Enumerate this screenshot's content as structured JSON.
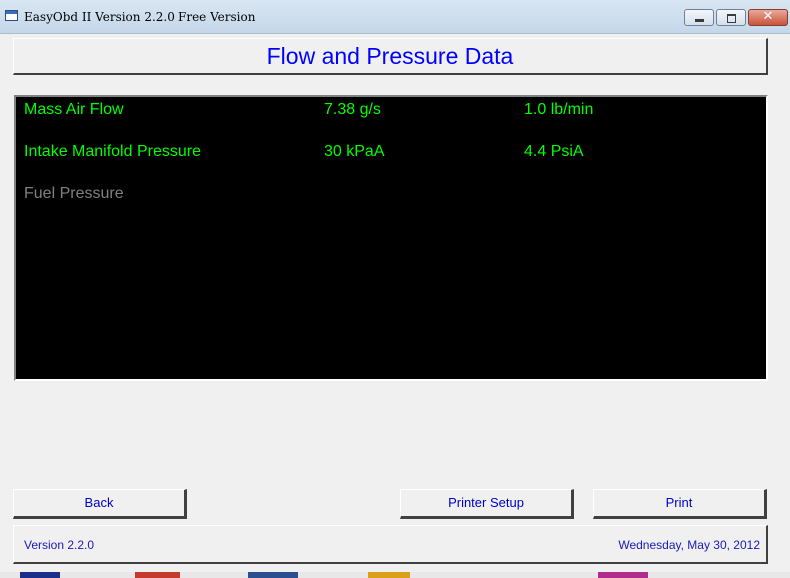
{
  "window": {
    "title": "EasyObd II Version 2.2.0",
    "edition": "Free Version",
    "close_glyph": "✕"
  },
  "header": {
    "title": "Flow and Pressure Data"
  },
  "data_rows": [
    {
      "name": "Mass Air Flow",
      "value_metric": "7.38 g/s",
      "value_imperial": "1.0 lb/min",
      "active": true
    },
    {
      "name": "Intake Manifold Pressure",
      "value_metric": "30 kPaA",
      "value_imperial": "4.4 PsiA",
      "active": true
    },
    {
      "name": "Fuel Pressure",
      "value_metric": "",
      "value_imperial": "",
      "active": false
    }
  ],
  "buttons": {
    "back": "Back",
    "printer_setup": "Printer Setup",
    "print": "Print"
  },
  "status": {
    "version": "Version 2.2.0",
    "date": "Wednesday, May 30, 2012"
  },
  "colors": {
    "active_text": "#00ff00",
    "inactive_text": "#808080",
    "header_text": "#0000ff",
    "panel_bg": "#000000",
    "button_text": "#0000c8"
  },
  "icons": {
    "app": "application-window-icon",
    "minimize": "minimize-icon",
    "maximize": "maximize-icon",
    "close": "close-icon"
  }
}
